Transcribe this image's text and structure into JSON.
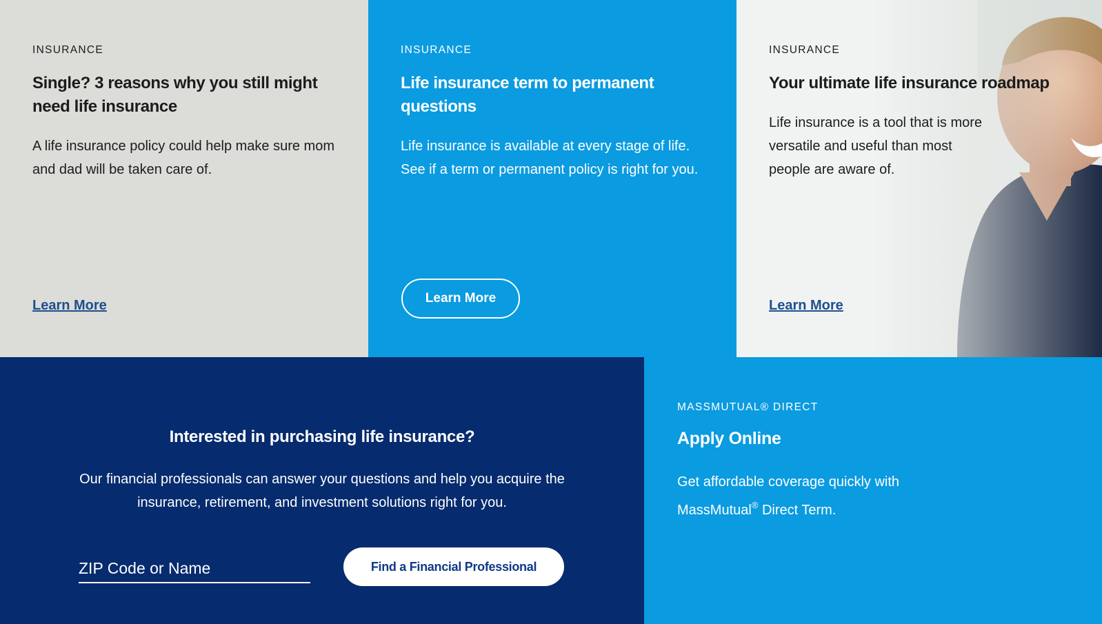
{
  "cards": [
    {
      "eyebrow": "INSURANCE",
      "title": "Single? 3 reasons why you still might need life insurance",
      "body": "A life insurance policy could help make sure mom and dad will be taken care of.",
      "cta": "Learn More"
    },
    {
      "eyebrow": "INSURANCE",
      "title": "Life insurance term to permanent questions",
      "body": "Life insurance is available at every stage of life. See if a term or permanent policy is right for you.",
      "cta": "Learn More"
    },
    {
      "eyebrow": "INSURANCE",
      "title": "Your ultimate life insurance roadmap",
      "body": "Life insurance is a tool that is more versatile and useful than most people are aware of.",
      "cta": "Learn More"
    }
  ],
  "find_professional": {
    "title": "Interested in purchasing life insurance?",
    "body": "Our financial professionals can answer your questions and help you acquire the insurance, retirement, and investment solutions right for you.",
    "input_placeholder": "ZIP Code or Name",
    "button_label": "Find a Financial Professional"
  },
  "apply_online": {
    "eyebrow": "MASSMUTUAL® DIRECT",
    "title": "Apply Online",
    "body_part1": "Get affordable coverage quickly with MassMutual",
    "registered_mark": "®",
    "body_part2": " Direct Term."
  },
  "colors": {
    "gray_tile": "#dcdcd8",
    "light_blue": "#0a9be0",
    "navy": "#062b6e",
    "link_blue": "#1d4f8e"
  }
}
